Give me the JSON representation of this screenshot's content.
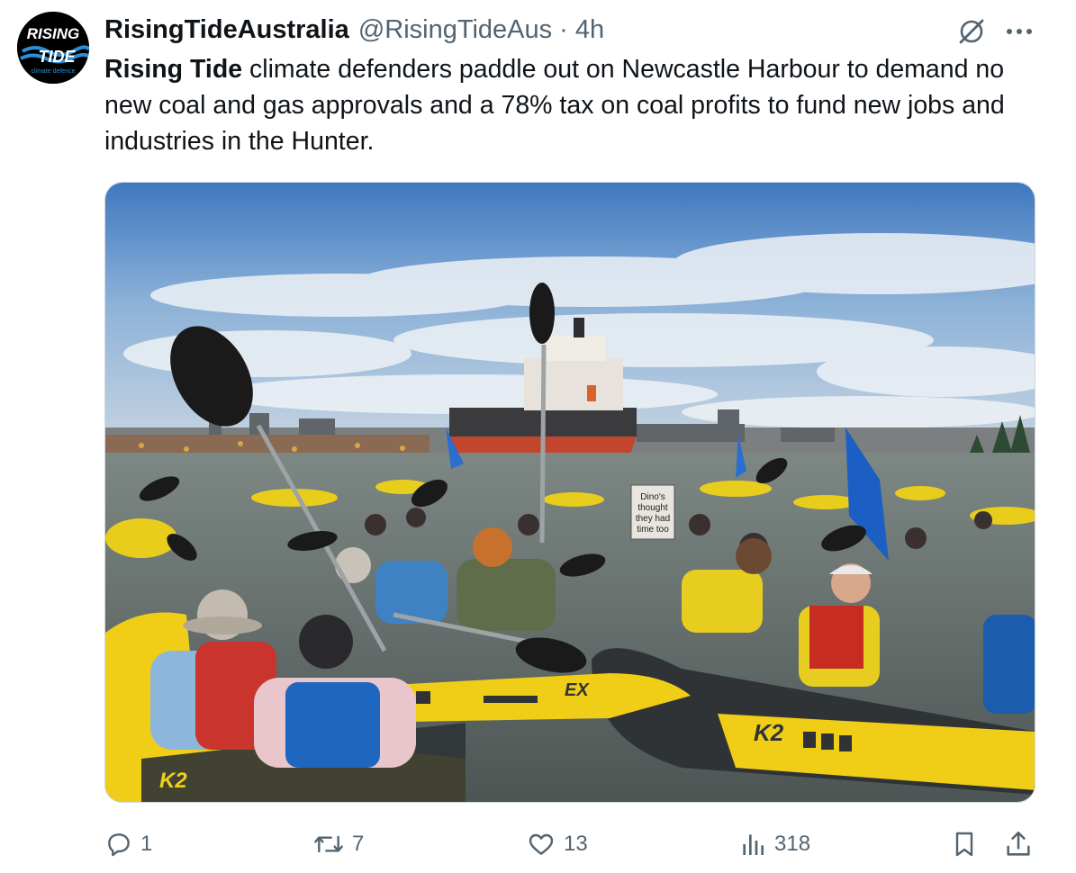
{
  "tweet": {
    "author_name": "RisingTideAustralia",
    "handle": "@RisingTideAus",
    "separator": "·",
    "time": "4h",
    "text_bold": "Rising Tide",
    "text_rest": " climate defenders paddle out on Newcastle Harbour to demand no new coal and gas approvals and a 78% tax on coal profits to fund new jobs and industries in the Hunter."
  },
  "avatar": {
    "line1": "RISING",
    "line2": "TIDE",
    "line3": "climate defence",
    "bg_color": "#000000",
    "accent_color": "#2a8fd6"
  },
  "photo": {
    "sign_line1": "Dino's",
    "sign_line2": "thought",
    "sign_line3": "they had",
    "sign_line4": "time too",
    "kayak_brand_left": "K2",
    "kayak_brand_right": "K2",
    "kayak_text_center": "EX",
    "colors": {
      "sky": "#4f86c6",
      "water": "#5d6b68",
      "kayak_yellow": "#f2d21a",
      "kayak_grey": "#3d4144",
      "ship_hull": "#c2462e",
      "flag_blue": "#1b5fc4"
    }
  },
  "actions": {
    "reply_count": "1",
    "retweet_count": "7",
    "like_count": "13",
    "views_count": "318"
  },
  "icons": {
    "grok": "grok-icon",
    "more": "more-icon",
    "reply": "reply-icon",
    "retweet": "retweet-icon",
    "like": "like-icon",
    "views": "views-icon",
    "bookmark": "bookmark-icon",
    "share": "share-icon"
  },
  "colors": {
    "text_primary": "#0f1419",
    "text_secondary": "#536471",
    "border": "#cfd9de"
  }
}
